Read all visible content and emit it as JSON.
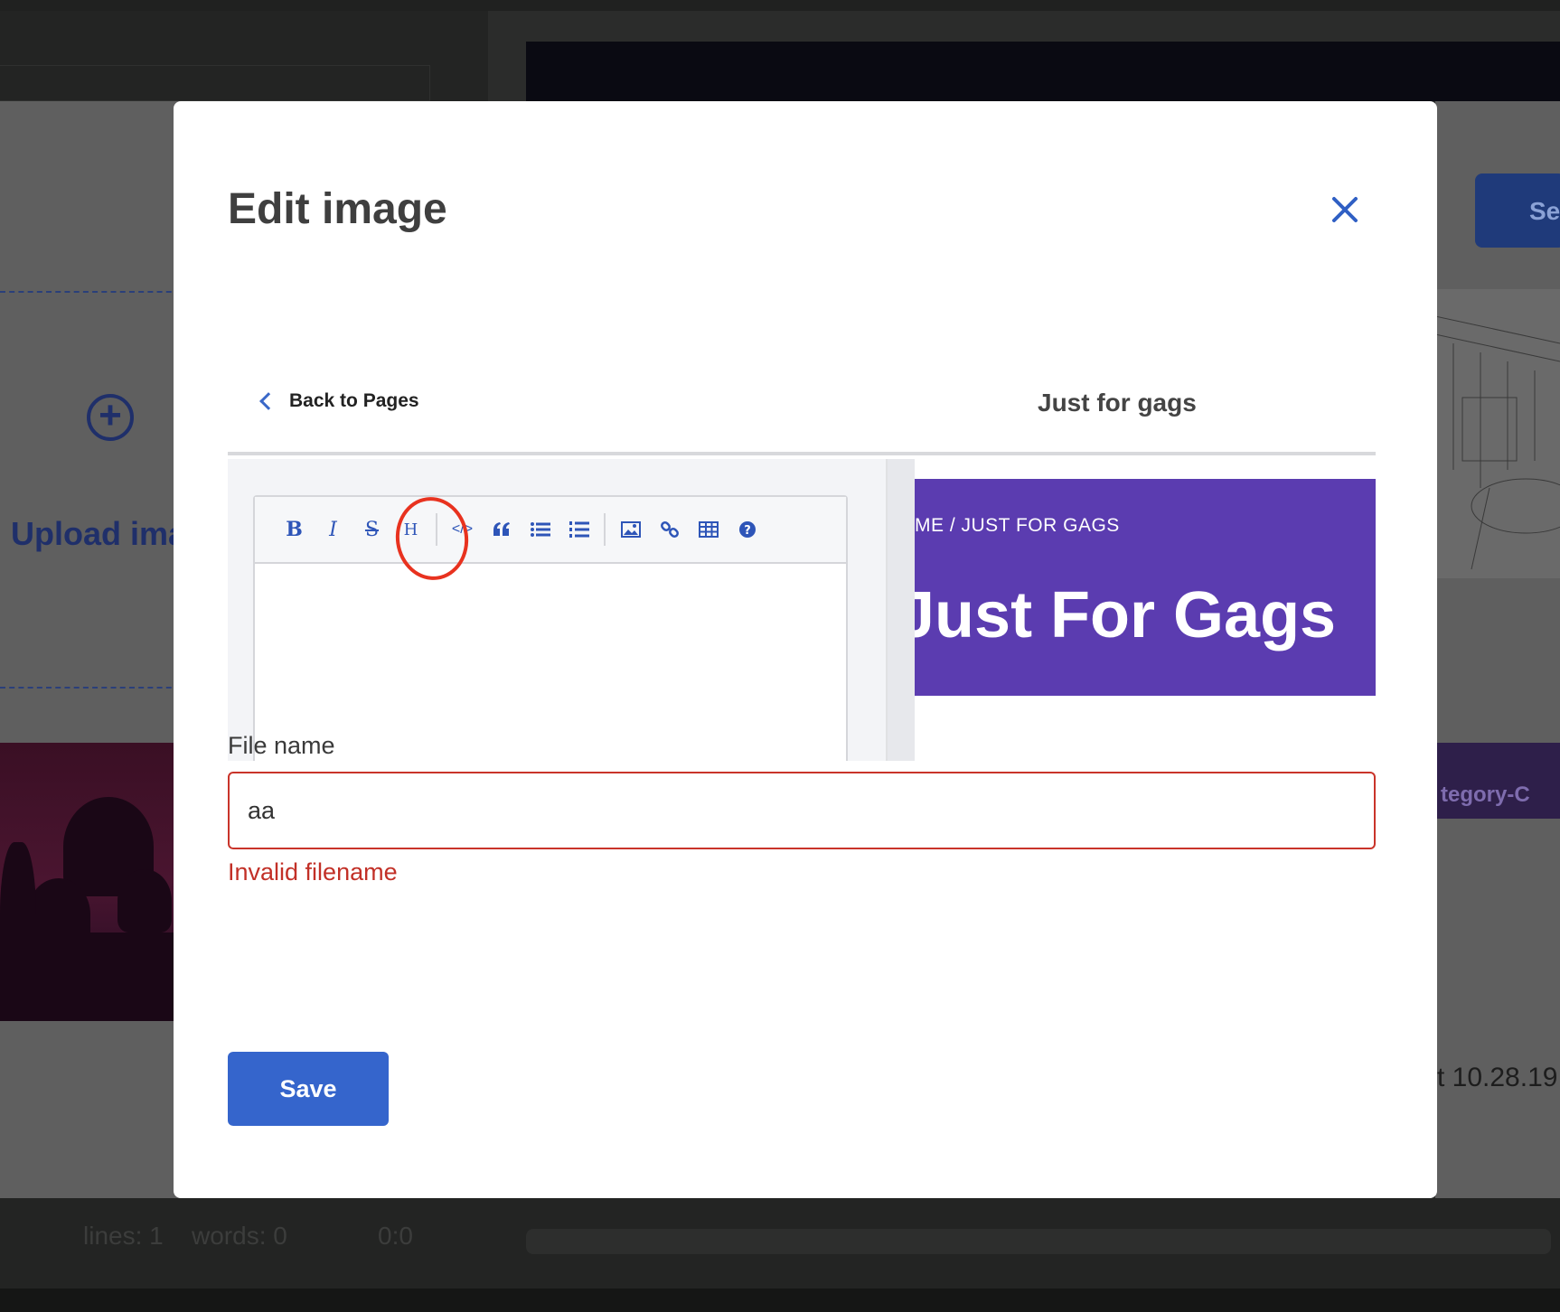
{
  "background": {
    "upload_label": "Upload ima",
    "select_button_label": "Sel",
    "category_label": "tegory-C",
    "date_label": "t 10.28.19",
    "status_lines": "lines: 1",
    "status_words": "words: 0",
    "status_cursor": "0:0"
  },
  "modal": {
    "title": "Edit image",
    "preview": {
      "back_link": "Back to Pages",
      "page_title": "Just for gags",
      "breadcrumb": "ME   /   JUST FOR GAGS",
      "hero_title": "Just For Gags",
      "toolbar": [
        "B",
        "I",
        "S",
        "H",
        "</>",
        "quote",
        "bulleted-list",
        "numbered-list",
        "image",
        "link",
        "table",
        "help"
      ]
    },
    "file_name": {
      "label": "File name",
      "value": "aa",
      "error": "Invalid filename"
    },
    "save_label": "Save"
  },
  "colors": {
    "accent": "#3565cc",
    "error": "#c23027",
    "hero": "#5b3cb0",
    "annotation": "#e8321f"
  }
}
